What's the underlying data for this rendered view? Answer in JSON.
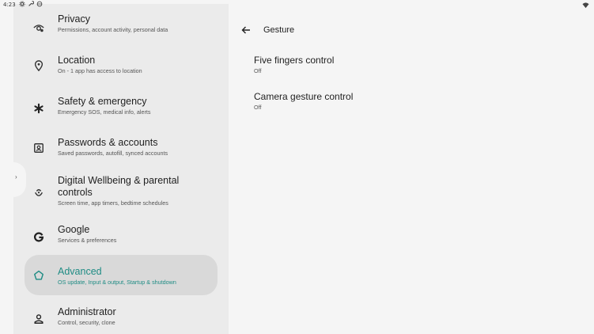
{
  "status_bar": {
    "time": "4:23",
    "icons": [
      "settings-icon",
      "wrench-icon",
      "target-icon",
      "wifi-icon"
    ]
  },
  "sidebar": {
    "items": [
      {
        "icon": "privacy-eye-icon",
        "title": "Privacy",
        "subtitle": "Permissions, account activity, personal data"
      },
      {
        "icon": "location-pin-icon",
        "title": "Location",
        "subtitle": "On - 1 app has access to location"
      },
      {
        "icon": "asterisk-icon",
        "title": "Safety & emergency",
        "subtitle": "Emergency SOS, medical info, alerts"
      },
      {
        "icon": "account-box-icon",
        "title": "Passwords & accounts",
        "subtitle": "Saved passwords, autofill, synced accounts"
      },
      {
        "icon": "wellbeing-icon",
        "title": "Digital Wellbeing & parental controls",
        "subtitle": "Screen time, app timers, bedtime schedules"
      },
      {
        "icon": "google-g-icon",
        "title": "Google",
        "subtitle": "Services & preferences"
      },
      {
        "icon": "advanced-star-icon",
        "title": "Advanced",
        "subtitle": "OS update, Input & output, Startup & shutdown",
        "selected": true
      },
      {
        "icon": "administrator-person-icon",
        "title": "Administrator",
        "subtitle": "Control, security, clone"
      }
    ]
  },
  "content": {
    "title": "Gesture",
    "settings": [
      {
        "title": "Five fingers control",
        "value": "Off"
      },
      {
        "title": "Camera gesture control",
        "value": "Off"
      }
    ]
  },
  "colors": {
    "accent": "#1f8c84",
    "sidebar_bg": "#ebebeb",
    "selected_bg": "#d9d9d9",
    "content_bg": "#f5f5f5"
  }
}
